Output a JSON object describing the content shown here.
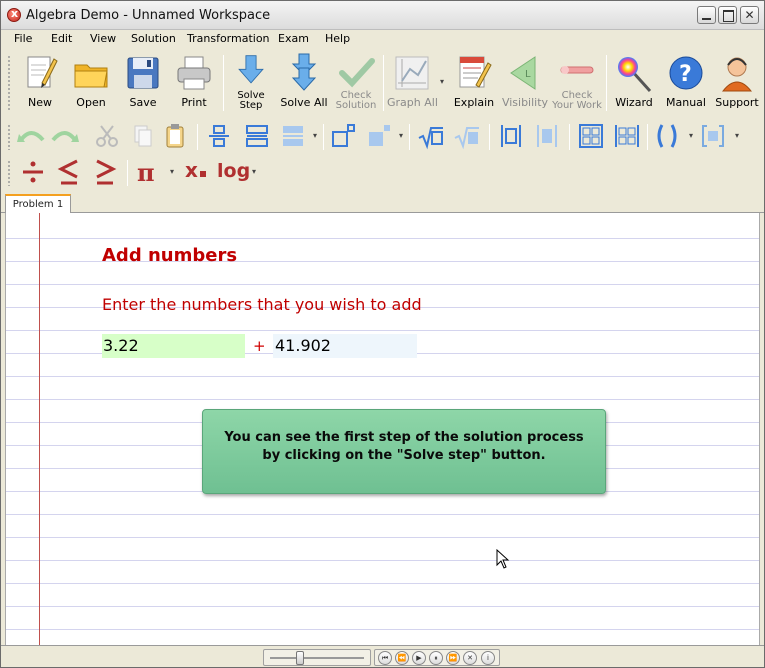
{
  "window": {
    "title": "Algebra Demo - Unnamed Workspace"
  },
  "menu": [
    "File",
    "Edit",
    "View",
    "Solution",
    "Transformation",
    "Exam",
    "Help"
  ],
  "toolbar": {
    "new": "New",
    "open": "Open",
    "save": "Save",
    "print": "Print",
    "solve_step_1": "Solve",
    "solve_step_2": "Step",
    "solve_all": "Solve All",
    "check_solution_1": "Check",
    "check_solution_2": "Solution",
    "graph_all": "Graph All",
    "explain": "Explain",
    "visibility": "Visibility",
    "check_work_1": "Check",
    "check_work_2": "Your Work",
    "wizard": "Wizard",
    "manual": "Manual",
    "support": "Support"
  },
  "math_toolbar": {
    "pi": "π",
    "subscript": "x",
    "log": "log"
  },
  "tabs": [
    "Problem 1"
  ],
  "problem": {
    "title": "Add numbers",
    "instruction": "Enter the numbers that you wish to add",
    "operand1": "3.22",
    "operator": "+",
    "operand2": "41.902"
  },
  "tip": {
    "line1": "You can see the first step of the solution process",
    "line2": "by clicking on the \"Solve step\" button."
  },
  "colors": {
    "accent_red": "#c00000",
    "tip_green": "#7cc99c",
    "operand1_bg": "#d7ffc8",
    "operand2_bg": "#eef6fc"
  }
}
